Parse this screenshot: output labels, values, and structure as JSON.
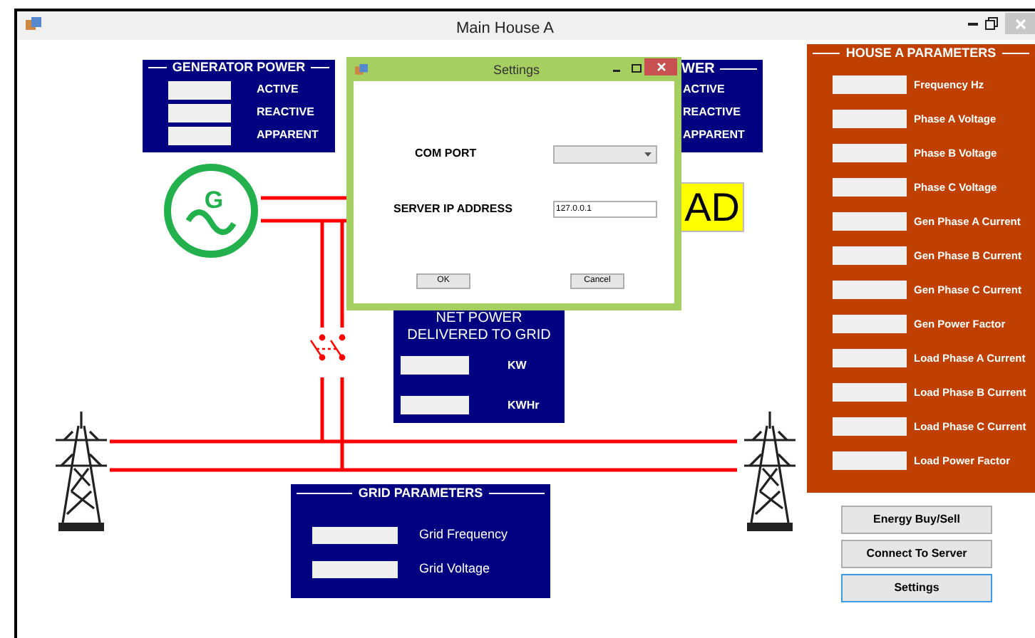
{
  "window": {
    "title": "Main House A"
  },
  "generator_power": {
    "title": "GENERATOR POWER",
    "fields": [
      {
        "label": "ACTIVE"
      },
      {
        "label": "REACTIVE"
      },
      {
        "label": "APPARENT"
      }
    ]
  },
  "second_power_panel": {
    "title": "WER",
    "fields": [
      {
        "label": "ACTIVE"
      },
      {
        "label": "REACTIVE"
      },
      {
        "label": "APPARENT"
      }
    ]
  },
  "generator": {
    "symbol": "G"
  },
  "load_indicator": {
    "text": "AD"
  },
  "net_power": {
    "title_lines": [
      "NET POWER",
      "DELIVERED TO GRID"
    ],
    "fields": [
      {
        "label": "KW"
      },
      {
        "label": "KWHr"
      }
    ]
  },
  "grid_parameters": {
    "title": "GRID PARAMETERS",
    "fields": [
      {
        "label": "Grid Frequency"
      },
      {
        "label": "Grid Voltage"
      }
    ]
  },
  "house_parameters": {
    "title": "HOUSE A PARAMETERS",
    "fields": [
      {
        "label": "Frequency Hz"
      },
      {
        "label": "Phase A Voltage"
      },
      {
        "label": "Phase B Voltage"
      },
      {
        "label": "Phase C Voltage"
      },
      {
        "label": "Gen Phase A Current"
      },
      {
        "label": "Gen Phase B Current"
      },
      {
        "label": "Gen Phase C Current"
      },
      {
        "label": "Gen Power Factor"
      },
      {
        "label": "Load Phase A Current"
      },
      {
        "label": "Load Phase B Current"
      },
      {
        "label": "Load Phase C Current"
      },
      {
        "label": "Load Power Factor"
      }
    ]
  },
  "buttons": [
    {
      "label": "Energy Buy/Sell",
      "focused": false
    },
    {
      "label": "Connect To Server",
      "focused": false
    },
    {
      "label": "Settings",
      "focused": true
    }
  ],
  "settings_dialog": {
    "title": "Settings",
    "com_port_label": "COM PORT",
    "server_ip_label": "SERVER IP ADDRESS",
    "server_ip_value": "127.0.0.1",
    "buttons": [
      "OK",
      "Cancel"
    ]
  }
}
